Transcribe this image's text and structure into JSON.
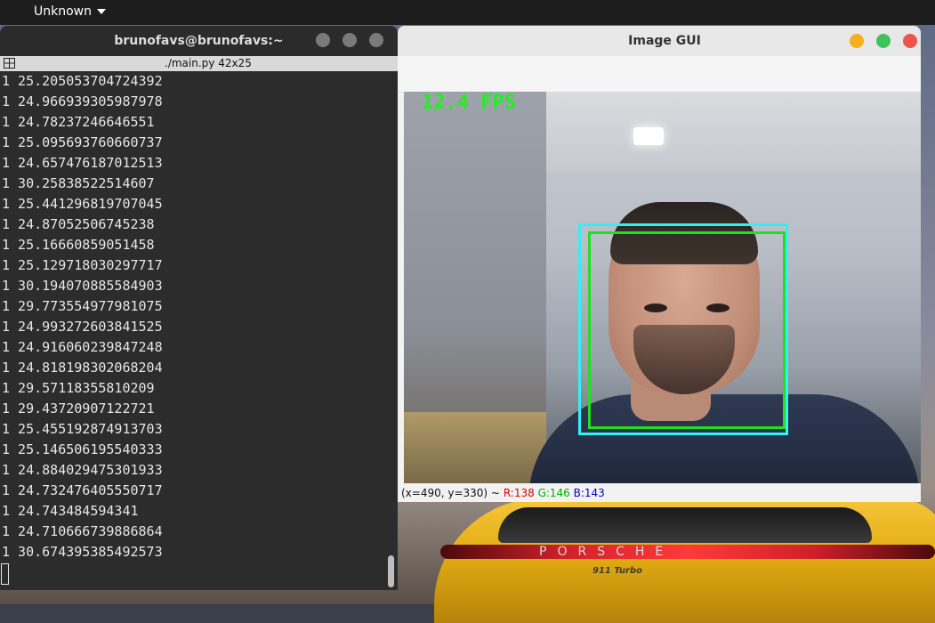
{
  "topbar": {
    "menu_label": "Unknown"
  },
  "terminal": {
    "title": "brunofavs@brunofavs:~",
    "tab_label": "./main.py 42x25",
    "lines": [
      "1 25.205053704724392",
      "1 24.966939305987978",
      "1 24.78237246646551",
      "1 25.095693760660737",
      "1 24.657476187012513",
      "1 30.25838522514607",
      "1 25.441296819707045",
      "1 24.87052506745238",
      "1 25.16660859051458",
      "1 25.129718030297717",
      "1 30.194070885584903",
      "1 29.773554977981075",
      "1 24.993272603841525",
      "1 24.916060239847248",
      "1 24.818198302068204",
      "1 29.57118355810209",
      "1 29.43720907122721",
      "1 25.455192874913703",
      "1 25.146506195540333",
      "1 24.884029475301933",
      "1 24.732476405550717",
      "1 24.743484594341",
      "1 24.710666739886864",
      "1 30.674395385492573"
    ]
  },
  "gui": {
    "title": "Image GUI",
    "fps_label": "12.4 FPS",
    "status_coords": "(x=490, y=330) ~",
    "status_r": "R:138",
    "status_g": "G:146",
    "status_b": "B:143",
    "colors": {
      "minimize": "#f5b01d",
      "maximize": "#3cc45a",
      "close": "#ef5350"
    }
  },
  "wallpaper": {
    "brand_text": "PORSCHE",
    "badge_text": "911 Turbo"
  }
}
